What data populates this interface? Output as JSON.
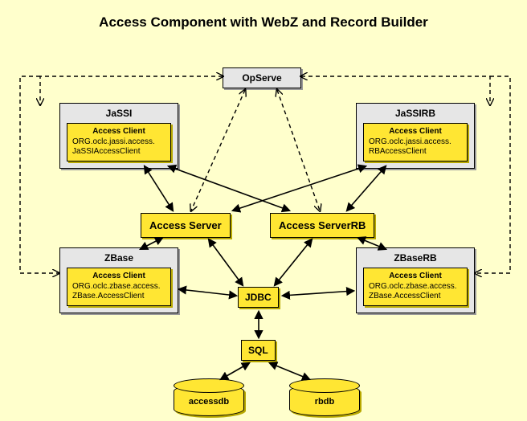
{
  "title": "Access Component with WebZ and Record Builder",
  "boxes": {
    "opserve": "OpServe",
    "jassi": {
      "name": "JaSSI",
      "ac_label": "Access Client",
      "ac_line1": "ORG.oclc.jassi.access.",
      "ac_line2": "JaSSIAccessClient"
    },
    "jassirb": {
      "name": "JaSSIRB",
      "ac_label": "Access Client",
      "ac_line1": "ORG.oclc.jassi.access.",
      "ac_line2": "RBAccessClient"
    },
    "zbase": {
      "name": "ZBase",
      "ac_label": "Access Client",
      "ac_line1": "ORG.oclc.zbase.access.",
      "ac_line2": "ZBase.AccessClient"
    },
    "zbaserb": {
      "name": "ZBaseRB",
      "ac_label": "Access Client",
      "ac_line1": "ORG.oclc.zbase.access.",
      "ac_line2": "ZBase.AccessClient"
    },
    "access_server": "Access Server",
    "access_server_rb": "Access ServerRB",
    "jdbc": "JDBC",
    "sql": "SQL",
    "accessdb": "accessdb",
    "rbdb": "rbdb"
  }
}
